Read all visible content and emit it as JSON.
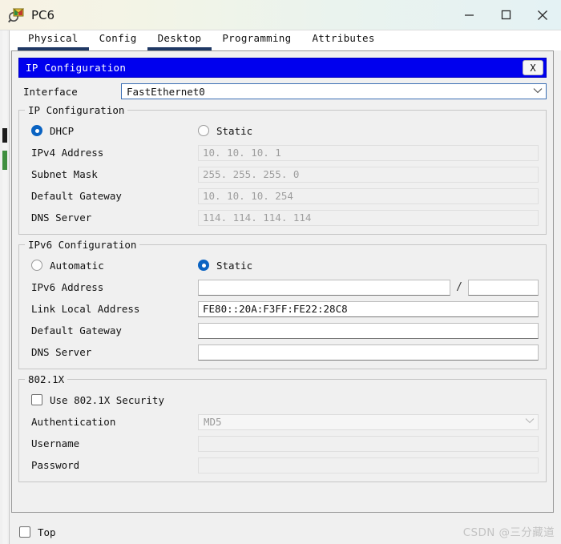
{
  "window": {
    "title": "PC6",
    "icon": "packet-tracer-device-icon",
    "controls": {
      "minimize": "—",
      "maximize": "□",
      "close": "✕"
    }
  },
  "tabs": [
    {
      "label": "Physical",
      "active": true
    },
    {
      "label": "Config",
      "active": false
    },
    {
      "label": "Desktop",
      "active": true
    },
    {
      "label": "Programming",
      "active": false
    },
    {
      "label": "Attributes",
      "active": false
    }
  ],
  "ip_configuration_window": {
    "title": "IP Configuration",
    "close_label": "X",
    "accent_color": "#0000ee"
  },
  "interface": {
    "label": "Interface",
    "value": "FastEthernet0",
    "chevron": "∨"
  },
  "ipv4": {
    "legend": "IP Configuration",
    "mode": {
      "dhcp_label": "DHCP",
      "static_label": "Static",
      "selected": "dhcp"
    },
    "fields": [
      {
        "label": "IPv4 Address",
        "value": "10. 10. 10. 1",
        "disabled": true
      },
      {
        "label": "Subnet Mask",
        "value": "255. 255. 255. 0",
        "disabled": true
      },
      {
        "label": "Default Gateway",
        "value": "10. 10. 10. 254",
        "disabled": true
      },
      {
        "label": "DNS Server",
        "value": "114. 114. 114. 114",
        "disabled": true
      }
    ]
  },
  "ipv6": {
    "legend": "IPv6 Configuration",
    "mode": {
      "automatic_label": "Automatic",
      "static_label": "Static",
      "selected": "static"
    },
    "address_row": {
      "label": "IPv6 Address",
      "value": "",
      "separator": "/",
      "prefix_value": ""
    },
    "fields": [
      {
        "label": "Link Local Address",
        "value": "FE80::20A:F3FF:FE22:28C8",
        "disabled": false
      },
      {
        "label": "Default Gateway",
        "value": "",
        "disabled": false
      },
      {
        "label": "DNS Server",
        "value": "",
        "disabled": false
      }
    ]
  },
  "dot1x": {
    "legend": "802.1X",
    "use_security_label": "Use 802.1X Security",
    "use_security_checked": false,
    "authentication": {
      "label": "Authentication",
      "value": "MD5",
      "chevron": "∨"
    },
    "username": {
      "label": "Username",
      "value": ""
    },
    "password": {
      "label": "Password",
      "value": ""
    }
  },
  "bottom": {
    "top_label": "Top",
    "top_checked": false,
    "watermark": "CSDN @三分藏道"
  }
}
